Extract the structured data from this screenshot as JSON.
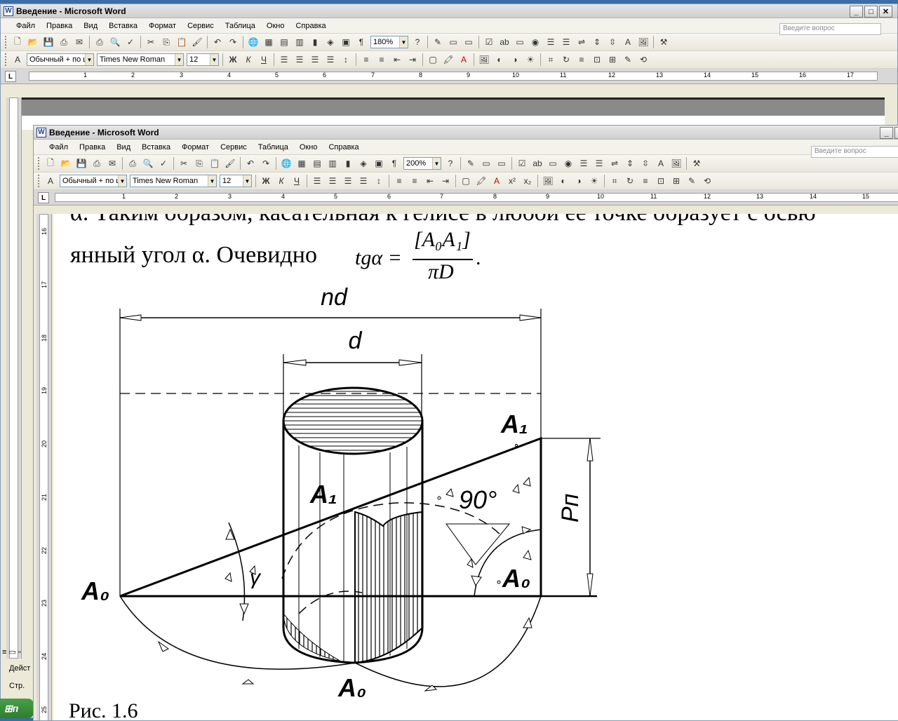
{
  "back_window": {
    "title": "Введение - Microsoft Word",
    "menu": [
      "Файл",
      "Правка",
      "Вид",
      "Вставка",
      "Формат",
      "Сервис",
      "Таблица",
      "Окно",
      "Справка"
    ],
    "ask_placeholder": "Введите вопрос",
    "zoom": "180%",
    "style": "Обычный + по ц",
    "font": "Times New Roman",
    "size": "12",
    "ruler_numbers": [
      "1",
      "2",
      "3",
      "4",
      "5",
      "6",
      "7",
      "8",
      "9",
      "10",
      "11",
      "12",
      "13",
      "14",
      "15",
      "16",
      "17"
    ],
    "status_actions": "Дейст",
    "status_page": "Стр."
  },
  "front_window": {
    "title": "Введение - Microsoft Word",
    "menu": [
      "Файл",
      "Правка",
      "Вид",
      "Вставка",
      "Формат",
      "Сервис",
      "Таблица",
      "Окно",
      "Справка"
    ],
    "ask_placeholder": "Введите вопрос",
    "zoom": "200%",
    "style": "Обычный + по ц",
    "font": "Times New Roman",
    "size": "12",
    "ruler_numbers": [
      "1",
      "2",
      "3",
      "4",
      "5",
      "6",
      "7",
      "8",
      "9",
      "10",
      "11",
      "12",
      "13",
      "14",
      "15"
    ],
    "vruler_numbers": [
      "16",
      "17",
      "18",
      "19",
      "20",
      "21",
      "22",
      "23",
      "24",
      "25"
    ]
  },
  "document": {
    "line_top": "α. Таким образом, касательная к гелисе в любой ее точке образует с осью",
    "line_main": "янный угол α. Очевидно",
    "formula_lhs": "tgα =",
    "formula_num": "[A₀A₁]",
    "formula_den": "πD",
    "formula_end": ".",
    "figure_labels": {
      "nd": "nd",
      "d": "d",
      "A1_right": "A₁",
      "A1_center": "A₁",
      "angle": "90°",
      "gamma": "γ",
      "Pn": "Pп",
      "A0_left": "A₀",
      "A0_right": "A₀",
      "A0_bottom": "A₀"
    },
    "caption": "Рис. 1.6"
  },
  "taskbar": {
    "start_label": "п"
  }
}
